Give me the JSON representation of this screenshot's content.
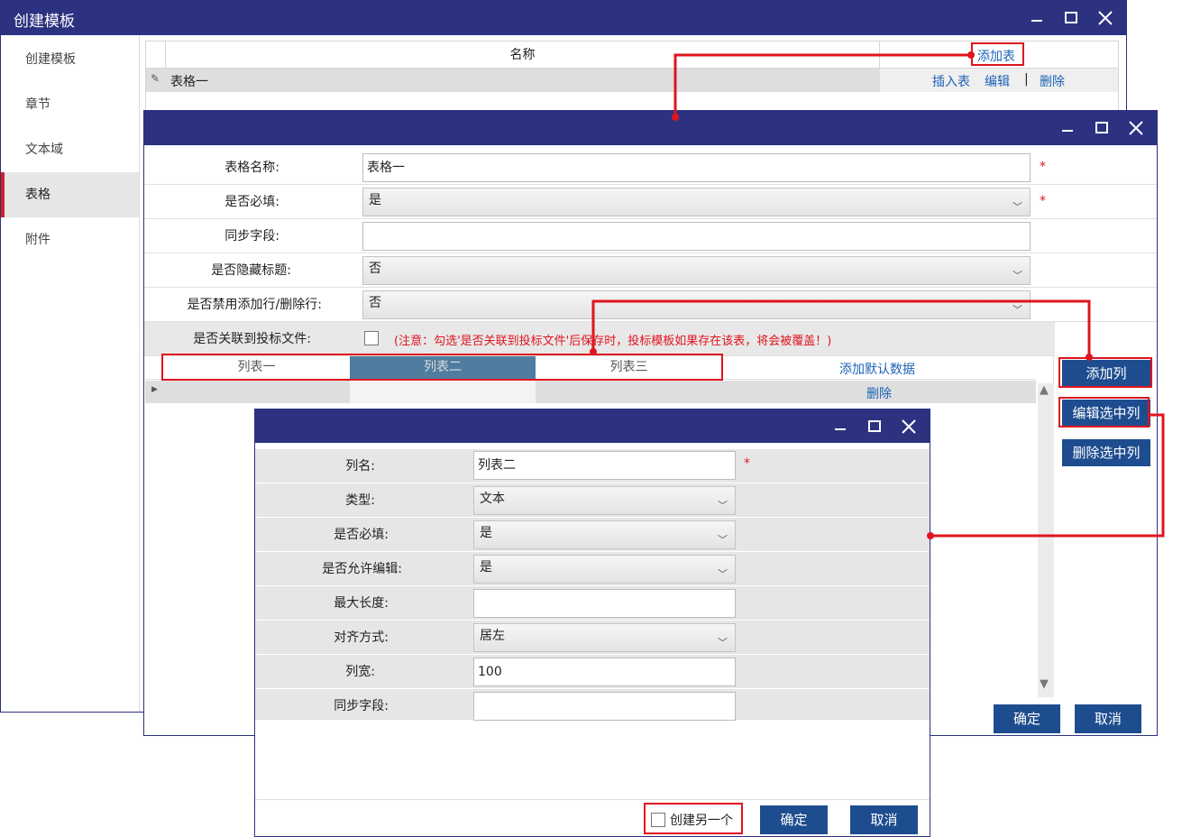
{
  "win1": {
    "title": "创建模板",
    "sidebar": [
      "创建模板",
      "章节",
      "文本域",
      "表格",
      "附件"
    ],
    "grid": {
      "header_name": "名称",
      "add_table": "添加表",
      "row_name": "表格一",
      "actions": [
        "插入表",
        "编辑",
        "|",
        "删除"
      ]
    }
  },
  "win2": {
    "fields": {
      "table_name_label": "表格名称:",
      "table_name_value": "表格一",
      "required_label": "是否必填:",
      "required_value": "是",
      "sync_label": "同步字段:",
      "sync_value": "",
      "hide_title_label": "是否隐藏标题:",
      "hide_title_value": "否",
      "disable_rows_label": "是否禁用添加行/删除行:",
      "disable_rows_value": "否",
      "link_bid_label": "是否关联到投标文件:",
      "link_bid_note": "(注意：勾选'是否关联到投标文件'后保存时，投标模板如果存在该表，将会被覆盖！)"
    },
    "columns": [
      "列表一",
      "列表二",
      "列表三"
    ],
    "add_default": "添加默认数据",
    "delete": "删除",
    "side_buttons": [
      "添加列",
      "编辑选中列",
      "删除选中列"
    ],
    "ok": "确定",
    "cancel": "取消",
    "star": "*"
  },
  "win3": {
    "fields": {
      "col_name_label": "列名:",
      "col_name_value": "列表二",
      "type_label": "类型:",
      "type_value": "文本",
      "required_label": "是否必填:",
      "required_value": "是",
      "editable_label": "是否允许编辑:",
      "editable_value": "是",
      "maxlen_label": "最大长度:",
      "maxlen_value": "",
      "align_label": "对齐方式:",
      "align_value": "居左",
      "width_label": "列宽:",
      "width_value": "100",
      "sync_label": "同步字段:",
      "sync_value": ""
    },
    "create_another": "创建另一个",
    "ok": "确定",
    "cancel": "取消",
    "star": "*"
  },
  "colors": {
    "title_bar": "#2c3280",
    "button": "#1e4d8f",
    "highlight": "#e0141e",
    "selected_col": "#4f7d9f"
  }
}
